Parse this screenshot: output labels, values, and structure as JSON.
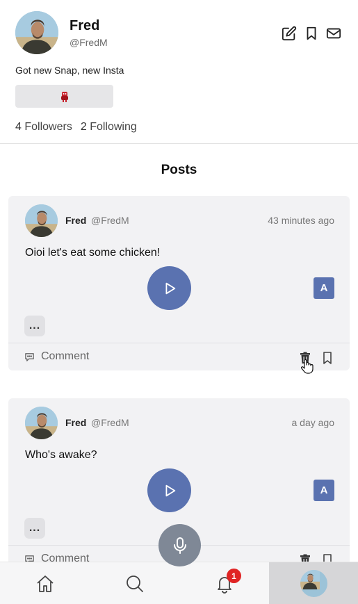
{
  "profile": {
    "name": "Fred",
    "handle": "@FredM",
    "bio": "Got new Snap, new Insta",
    "followers_count": "4",
    "followers_label": "Followers",
    "following_count": "2",
    "following_label": "Following"
  },
  "header_icons": [
    "edit-icon",
    "bookmark-icon",
    "mail-icon"
  ],
  "posts_title": "Posts",
  "posts": [
    {
      "author": "Fred",
      "handle": "@FredM",
      "time": "43 minutes ago",
      "text": "Oioi let's eat some chicken!",
      "lang": "A",
      "more": "...",
      "comment_label": "Comment"
    },
    {
      "author": "Fred",
      "handle": "@FredM",
      "time": "a day ago",
      "text": "Who's awake?",
      "lang": "A",
      "more": "...",
      "comment_label": "Comment"
    }
  ],
  "nav": {
    "items": [
      "home-icon",
      "search-icon",
      "bell-icon",
      "profile-avatar"
    ],
    "notification_count": "1"
  },
  "colors": {
    "accent": "#5a72b0",
    "card_bg": "#f2f2f4",
    "badge_red": "#e02424",
    "mic_gray": "#7f8896"
  }
}
